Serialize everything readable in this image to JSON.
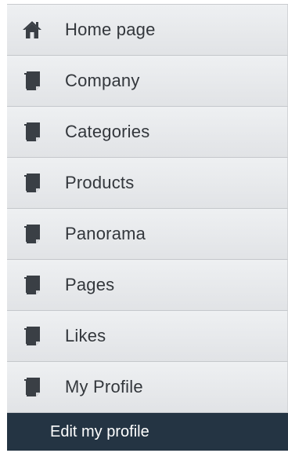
{
  "menu": {
    "items": [
      {
        "label": "Home page",
        "icon": "home-icon"
      },
      {
        "label": "Company",
        "icon": "page-icon"
      },
      {
        "label": "Categories",
        "icon": "page-icon"
      },
      {
        "label": "Products",
        "icon": "page-icon"
      },
      {
        "label": "Panorama",
        "icon": "page-icon"
      },
      {
        "label": "Pages",
        "icon": "page-icon"
      },
      {
        "label": "Likes",
        "icon": "page-icon"
      },
      {
        "label": "My Profile",
        "icon": "page-icon"
      }
    ],
    "submenu": {
      "label": "Edit my profile"
    }
  },
  "colors": {
    "item_background": "#e6e8eb",
    "item_text": "#33373c",
    "submenu_background": "#243443",
    "submenu_text": "#ffffff",
    "icon_color": "#3a3f45"
  }
}
